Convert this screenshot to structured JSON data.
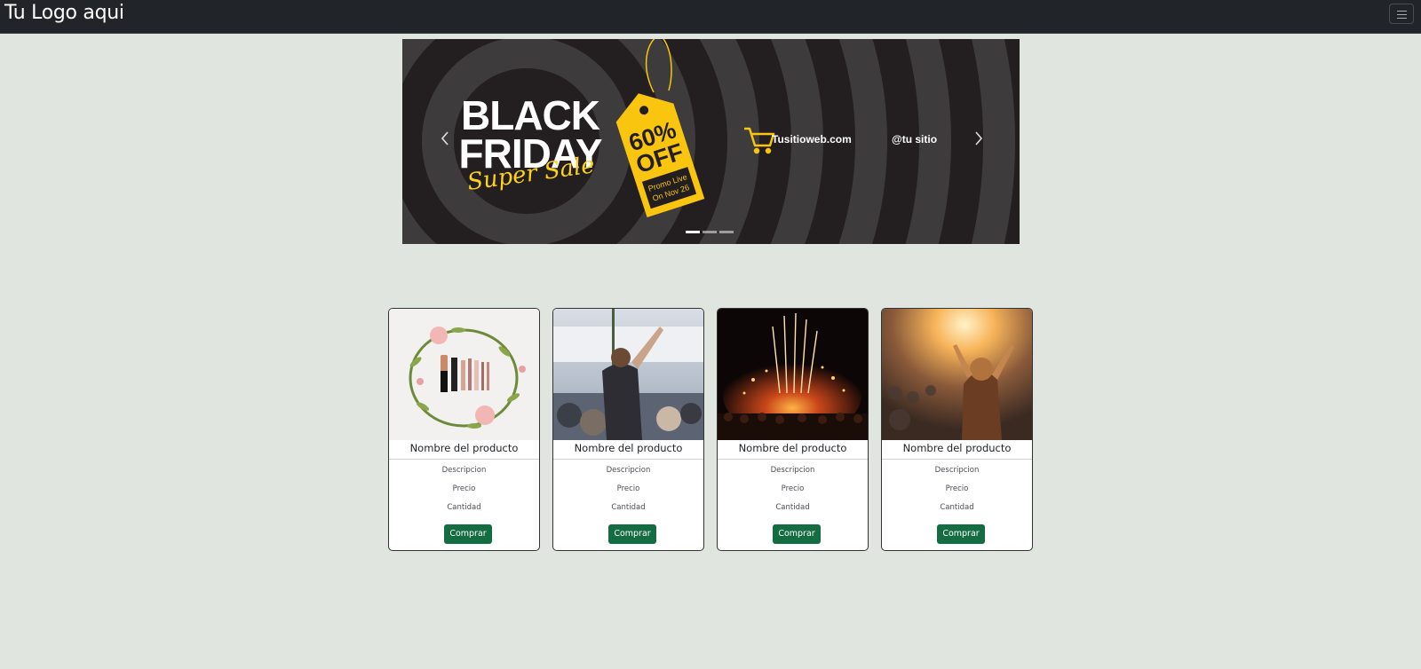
{
  "navbar": {
    "brand": "Tu Logo aqui",
    "toggler_icon": "hamburger-menu-icon"
  },
  "carousel": {
    "slide": {
      "headline_line1": "BLACK",
      "headline_line2": "FRIDAY",
      "script_text": "Super Sale",
      "tag_line1": "60%",
      "tag_line2": "OFF",
      "tag_promo_line1": "Promo Live",
      "tag_promo_line2": "On Nov 26",
      "website": "Tusitioweb.com",
      "handle": "@tu sitio",
      "cart_icon": "shopping-cart-icon",
      "colors": {
        "background": "#231f20",
        "rings": "#3d3b3c",
        "accent": "#f9c50f"
      }
    },
    "prev_icon": "chevron-left-icon",
    "next_icon": "chevron-right-icon",
    "indicator_count": 3,
    "active_indicator": 1
  },
  "products": [
    {
      "image": "makeup-flatlay-image",
      "name": "Nombre del producto",
      "description": "Descripcion",
      "price": "Precio",
      "quantity": "Cantidad",
      "button": "Comprar"
    },
    {
      "image": "concert-crowd-image",
      "name": "Nombre del producto",
      "description": "Descripcion",
      "price": "Precio",
      "quantity": "Cantidad",
      "button": "Comprar"
    },
    {
      "image": "fireworks-stage-image",
      "name": "Nombre del producto",
      "description": "Descripcion",
      "price": "Precio",
      "quantity": "Cantidad",
      "button": "Comprar"
    },
    {
      "image": "sunset-festival-image",
      "name": "Nombre del producto",
      "description": "Descripcion",
      "price": "Precio",
      "quantity": "Cantidad",
      "button": "Comprar"
    }
  ],
  "colors": {
    "page_background": "#e1e5df",
    "navbar": "#212529",
    "button": "#146c43"
  }
}
